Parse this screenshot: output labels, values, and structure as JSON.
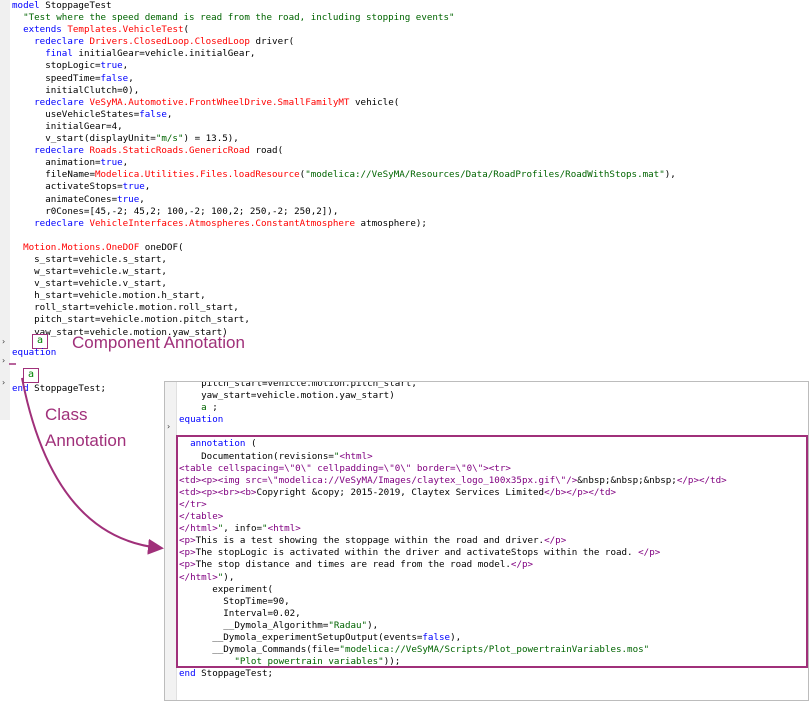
{
  "editor": {
    "lines": [
      [
        [
          "kw",
          "model"
        ],
        [
          "t",
          " StoppageTest"
        ]
      ],
      [
        [
          "str",
          "  \"Test where the speed demand is read from the road, including stopping events\""
        ]
      ],
      [
        [
          "t",
          "  "
        ],
        [
          "kw",
          "extends"
        ],
        [
          "t",
          " "
        ],
        [
          "cls",
          "Templates.VehicleTest"
        ],
        [
          "t",
          "("
        ]
      ],
      [
        [
          "t",
          "    "
        ],
        [
          "kw",
          "redeclare"
        ],
        [
          "t",
          " "
        ],
        [
          "cls",
          "Drivers.ClosedLoop.ClosedLoop"
        ],
        [
          "t",
          " driver("
        ]
      ],
      [
        [
          "t",
          "      "
        ],
        [
          "kw",
          "final"
        ],
        [
          "t",
          " initialGear=vehicle.initialGear,"
        ]
      ],
      [
        [
          "t",
          "      stopLogic="
        ],
        [
          "kw",
          "true"
        ],
        [
          "t",
          ","
        ]
      ],
      [
        [
          "t",
          "      speedTime="
        ],
        [
          "kw",
          "false"
        ],
        [
          "t",
          ","
        ]
      ],
      [
        [
          "t",
          "      initialClutch=0),"
        ]
      ],
      [
        [
          "t",
          "    "
        ],
        [
          "kw",
          "redeclare"
        ],
        [
          "t",
          " "
        ],
        [
          "cls",
          "VeSyMA.Automotive.FrontWheelDrive.SmallFamilyMT"
        ],
        [
          "t",
          " vehicle("
        ]
      ],
      [
        [
          "t",
          "      useVehicleStates="
        ],
        [
          "kw",
          "false"
        ],
        [
          "t",
          ","
        ]
      ],
      [
        [
          "t",
          "      initialGear=4,"
        ]
      ],
      [
        [
          "t",
          "      v_start(displayUnit="
        ],
        [
          "str",
          "\"m/s\""
        ],
        [
          "t",
          ") = 13.5),"
        ]
      ],
      [
        [
          "t",
          "    "
        ],
        [
          "kw",
          "redeclare"
        ],
        [
          "t",
          " "
        ],
        [
          "cls",
          "Roads.StaticRoads.GenericRoad"
        ],
        [
          "t",
          " road("
        ]
      ],
      [
        [
          "t",
          "      animation="
        ],
        [
          "kw",
          "true"
        ],
        [
          "t",
          ","
        ]
      ],
      [
        [
          "t",
          "      fileName="
        ],
        [
          "cls",
          "Modelica.Utilities.Files.loadResource"
        ],
        [
          "t",
          "("
        ],
        [
          "str",
          "\"modelica://VeSyMA/Resources/Data/RoadProfiles/RoadWithStops.mat\""
        ],
        [
          "t",
          "),"
        ]
      ],
      [
        [
          "t",
          "      activateStops="
        ],
        [
          "kw",
          "true"
        ],
        [
          "t",
          ","
        ]
      ],
      [
        [
          "t",
          "      animateCones="
        ],
        [
          "kw",
          "true"
        ],
        [
          "t",
          ","
        ]
      ],
      [
        [
          "t",
          "      r0Cones=[45,-2; 45,2; 100,-2; 100,2; 250,-2; 250,2]),"
        ]
      ],
      [
        [
          "t",
          "    "
        ],
        [
          "kw",
          "redeclare"
        ],
        [
          "t",
          " "
        ],
        [
          "cls",
          "VehicleInterfaces.Atmospheres.ConstantAtmosphere"
        ],
        [
          "t",
          " atmosphere);"
        ]
      ],
      [
        [
          "t",
          ""
        ]
      ],
      [
        [
          "t",
          "  "
        ],
        [
          "cls",
          "Motion.Motions.OneDOF"
        ],
        [
          "t",
          " oneDOF("
        ]
      ],
      [
        [
          "t",
          "    s_start=vehicle.s_start,"
        ]
      ],
      [
        [
          "t",
          "    w_start=vehicle.w_start,"
        ]
      ],
      [
        [
          "t",
          "    v_start=vehicle.v_start,"
        ]
      ],
      [
        [
          "t",
          "    h_start=vehicle.motion.h_start,"
        ]
      ],
      [
        [
          "t",
          "    roll_start=vehicle.motion.roll_start,"
        ]
      ],
      [
        [
          "t",
          "    pitch_start=vehicle.motion.pitch_start,"
        ]
      ],
      [
        [
          "t",
          "    yaw_start=vehicle.motion.yaw_start)"
        ]
      ]
    ],
    "equation_kw": "equation",
    "end_line": "end StoppageTest;",
    "end_kw": "end",
    "end_rest": " StoppageTest;"
  },
  "annotations": {
    "component_label": "Component Annotation",
    "class_label_1": "Class",
    "class_label_2": "Annotation",
    "icon_glyph": "a",
    "accent_color": "#a0307a"
  },
  "inset": {
    "lines": [
      [
        [
          "t",
          "    pitch_start=vehicle.motion.pitch_start,"
        ]
      ],
      [
        [
          "t",
          "    yaw_start=vehicle.motion.yaw_start)"
        ]
      ],
      [
        [
          "t",
          "    "
        ],
        [
          "str",
          "a"
        ],
        [
          "t",
          " ;"
        ]
      ],
      [
        [
          "kw",
          "equation"
        ]
      ],
      [
        [
          "t",
          ""
        ]
      ],
      [
        [
          "t",
          "  "
        ],
        [
          "kw",
          "annotation"
        ],
        [
          "t",
          " ("
        ]
      ],
      [
        [
          "t",
          "    Documentation(revisions="
        ],
        [
          "str",
          "\""
        ],
        [
          "tag",
          "<html>"
        ]
      ],
      [
        [
          "tag",
          "<table cellspacing=\\\"0\\\" cellpadding=\\\"0\\\" border=\\\"0\\\"><tr>"
        ]
      ],
      [
        [
          "tag",
          "<td><p><img src=\\\"modelica://VeSyMA/Images/claytex_logo_100x35px.gif\\\"/>"
        ],
        [
          "t",
          "&nbsp;&nbsp;&nbsp;"
        ],
        [
          "tag",
          "</p></td>"
        ]
      ],
      [
        [
          "tag",
          "<td><p><br><b>"
        ],
        [
          "t",
          "Copyright &copy; 2015-2019, Claytex Services Limited"
        ],
        [
          "tag",
          "</b></p></td>"
        ]
      ],
      [
        [
          "tag",
          "</tr>"
        ]
      ],
      [
        [
          "tag",
          "</table>"
        ]
      ],
      [
        [
          "tag",
          "</html>"
        ],
        [
          "str",
          "\""
        ],
        [
          "t",
          ", info="
        ],
        [
          "str",
          "\""
        ],
        [
          "tag",
          "<html>"
        ]
      ],
      [
        [
          "tag",
          "<p>"
        ],
        [
          "t",
          "This is a test showing the stoppage within the road and driver."
        ],
        [
          "tag",
          "</p>"
        ]
      ],
      [
        [
          "tag",
          "<p>"
        ],
        [
          "t",
          "The stopLogic is activated within the driver and activateStops within the road. "
        ],
        [
          "tag",
          "</p>"
        ]
      ],
      [
        [
          "tag",
          "<p>"
        ],
        [
          "t",
          "The stop distance and times are read from the road model."
        ],
        [
          "tag",
          "</p>"
        ]
      ],
      [
        [
          "tag",
          "</html>"
        ],
        [
          "str",
          "\""
        ],
        [
          "t",
          "),"
        ]
      ],
      [
        [
          "t",
          "      experiment("
        ]
      ],
      [
        [
          "t",
          "        StopTime=90,"
        ]
      ],
      [
        [
          "t",
          "        Interval=0.02,"
        ]
      ],
      [
        [
          "t",
          "        __Dymola_Algorithm="
        ],
        [
          "str",
          "\"Radau\""
        ],
        [
          "t",
          "),"
        ]
      ],
      [
        [
          "t",
          "      __Dymola_experimentSetupOutput(events="
        ],
        [
          "kw",
          "false"
        ],
        [
          "t",
          "),"
        ]
      ],
      [
        [
          "t",
          "      __Dymola_Commands(file="
        ],
        [
          "str",
          "\"modelica://VeSyMA/Scripts/Plot_powertrainVariables.mos\""
        ]
      ],
      [
        [
          "t",
          "          "
        ],
        [
          "str",
          "\"Plot powertrain variables\""
        ],
        [
          "t",
          "));"
        ]
      ],
      [
        [
          "kw",
          "end"
        ],
        [
          "t",
          " StoppageTest;"
        ]
      ]
    ]
  }
}
